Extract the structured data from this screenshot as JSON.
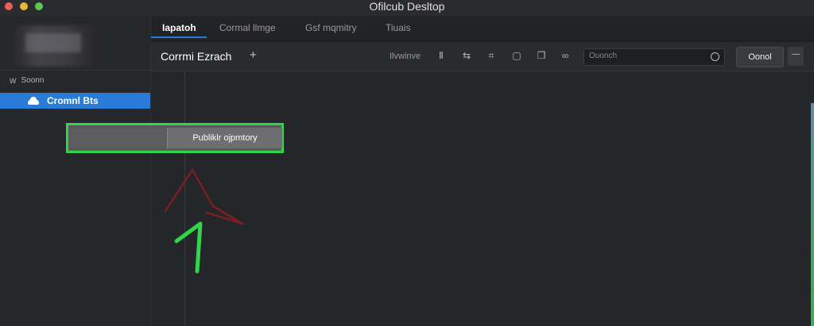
{
  "window": {
    "title": "Ofilcub Desltop",
    "traffic_lights": {
      "close": "#ec5f57",
      "minimize": "#e5b83a",
      "maximize": "#5cc64f"
    }
  },
  "sidebar": {
    "section_label": "Soonn",
    "items": [
      {
        "label": "Cromnl Bts",
        "icon": "cloud-icon",
        "selected": true
      }
    ]
  },
  "tabs": [
    {
      "label": "Iapatoh",
      "active": true
    },
    {
      "label": "Cormal llmge"
    },
    {
      "label": "Gsf mqmitry"
    },
    {
      "label": "Tiuais"
    }
  ],
  "toolbar": {
    "branch_title": "Corrmi Ezrach",
    "add_label": "+",
    "preview_label": "Ilvwinve",
    "icons": [
      "text-cursor-icon",
      "split-icon",
      "grid-icon",
      "folder-icon",
      "copy-icon",
      "link-icon"
    ],
    "search_placeholder": "Ouonch",
    "cancel_label": "Oonol",
    "more_label": "—"
  },
  "callout": {
    "publish_label": "Publiklr ojpmtory",
    "highlight_color": "#2fd64a"
  },
  "colors": {
    "accent": "#2a7bd8",
    "background": "#1f2023"
  }
}
